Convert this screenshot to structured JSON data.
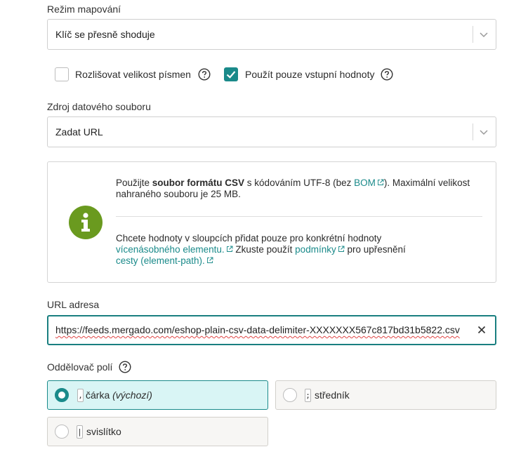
{
  "mapping_mode": {
    "label": "Režim mapování",
    "value": "Klíč se přesně shoduje"
  },
  "options": {
    "case_sensitive_label": "Rozlišovat velikost písmen",
    "case_sensitive_checked": false,
    "input_only_label": "Použít pouze vstupní hodnoty",
    "input_only_checked": true
  },
  "data_source": {
    "label": "Zdroj datového souboru",
    "value": "Zadat URL"
  },
  "info": {
    "p1_pre": "Použijte ",
    "p1_bold": "soubor formátu CSV",
    "p1_mid": " s kódováním UTF-8 (bez ",
    "p1_link": "BOM",
    "p1_post": "). Maximální velikost nahraného souboru je 25 MB.",
    "p2_pre": "Chcete hodnoty v sloupcích přidat pouze pro konkrétní hodnoty ",
    "p2_link1": "vícenásobného elementu.",
    "p2_mid": " Zkuste použít ",
    "p2_link2": "podmínky",
    "p2_mid2": " pro upřesnění ",
    "p2_link3": "cesty (element-path)."
  },
  "url": {
    "label": "URL adresa",
    "value": "https://feeds.mergado.com/eshop-plain-csv-data-delimiter-XXXXXXX567c817bd31b5822.csv"
  },
  "delimiter": {
    "label": "Oddělovač polí",
    "options": [
      {
        "key": ",",
        "name": "čárka",
        "note": "(výchozí)",
        "selected": true
      },
      {
        "key": ";",
        "name": "středník",
        "note": "",
        "selected": false
      },
      {
        "key": "|",
        "name": "svislítko",
        "note": "",
        "selected": false
      }
    ]
  },
  "colors": {
    "accent": "#1a8a8a",
    "info_icon": "#6a9a1f",
    "selected_bg": "#d9f5f5"
  },
  "icons": [
    "chevron-down-icon",
    "help-icon",
    "check-icon",
    "info-icon",
    "external-link-icon",
    "close-icon"
  ]
}
